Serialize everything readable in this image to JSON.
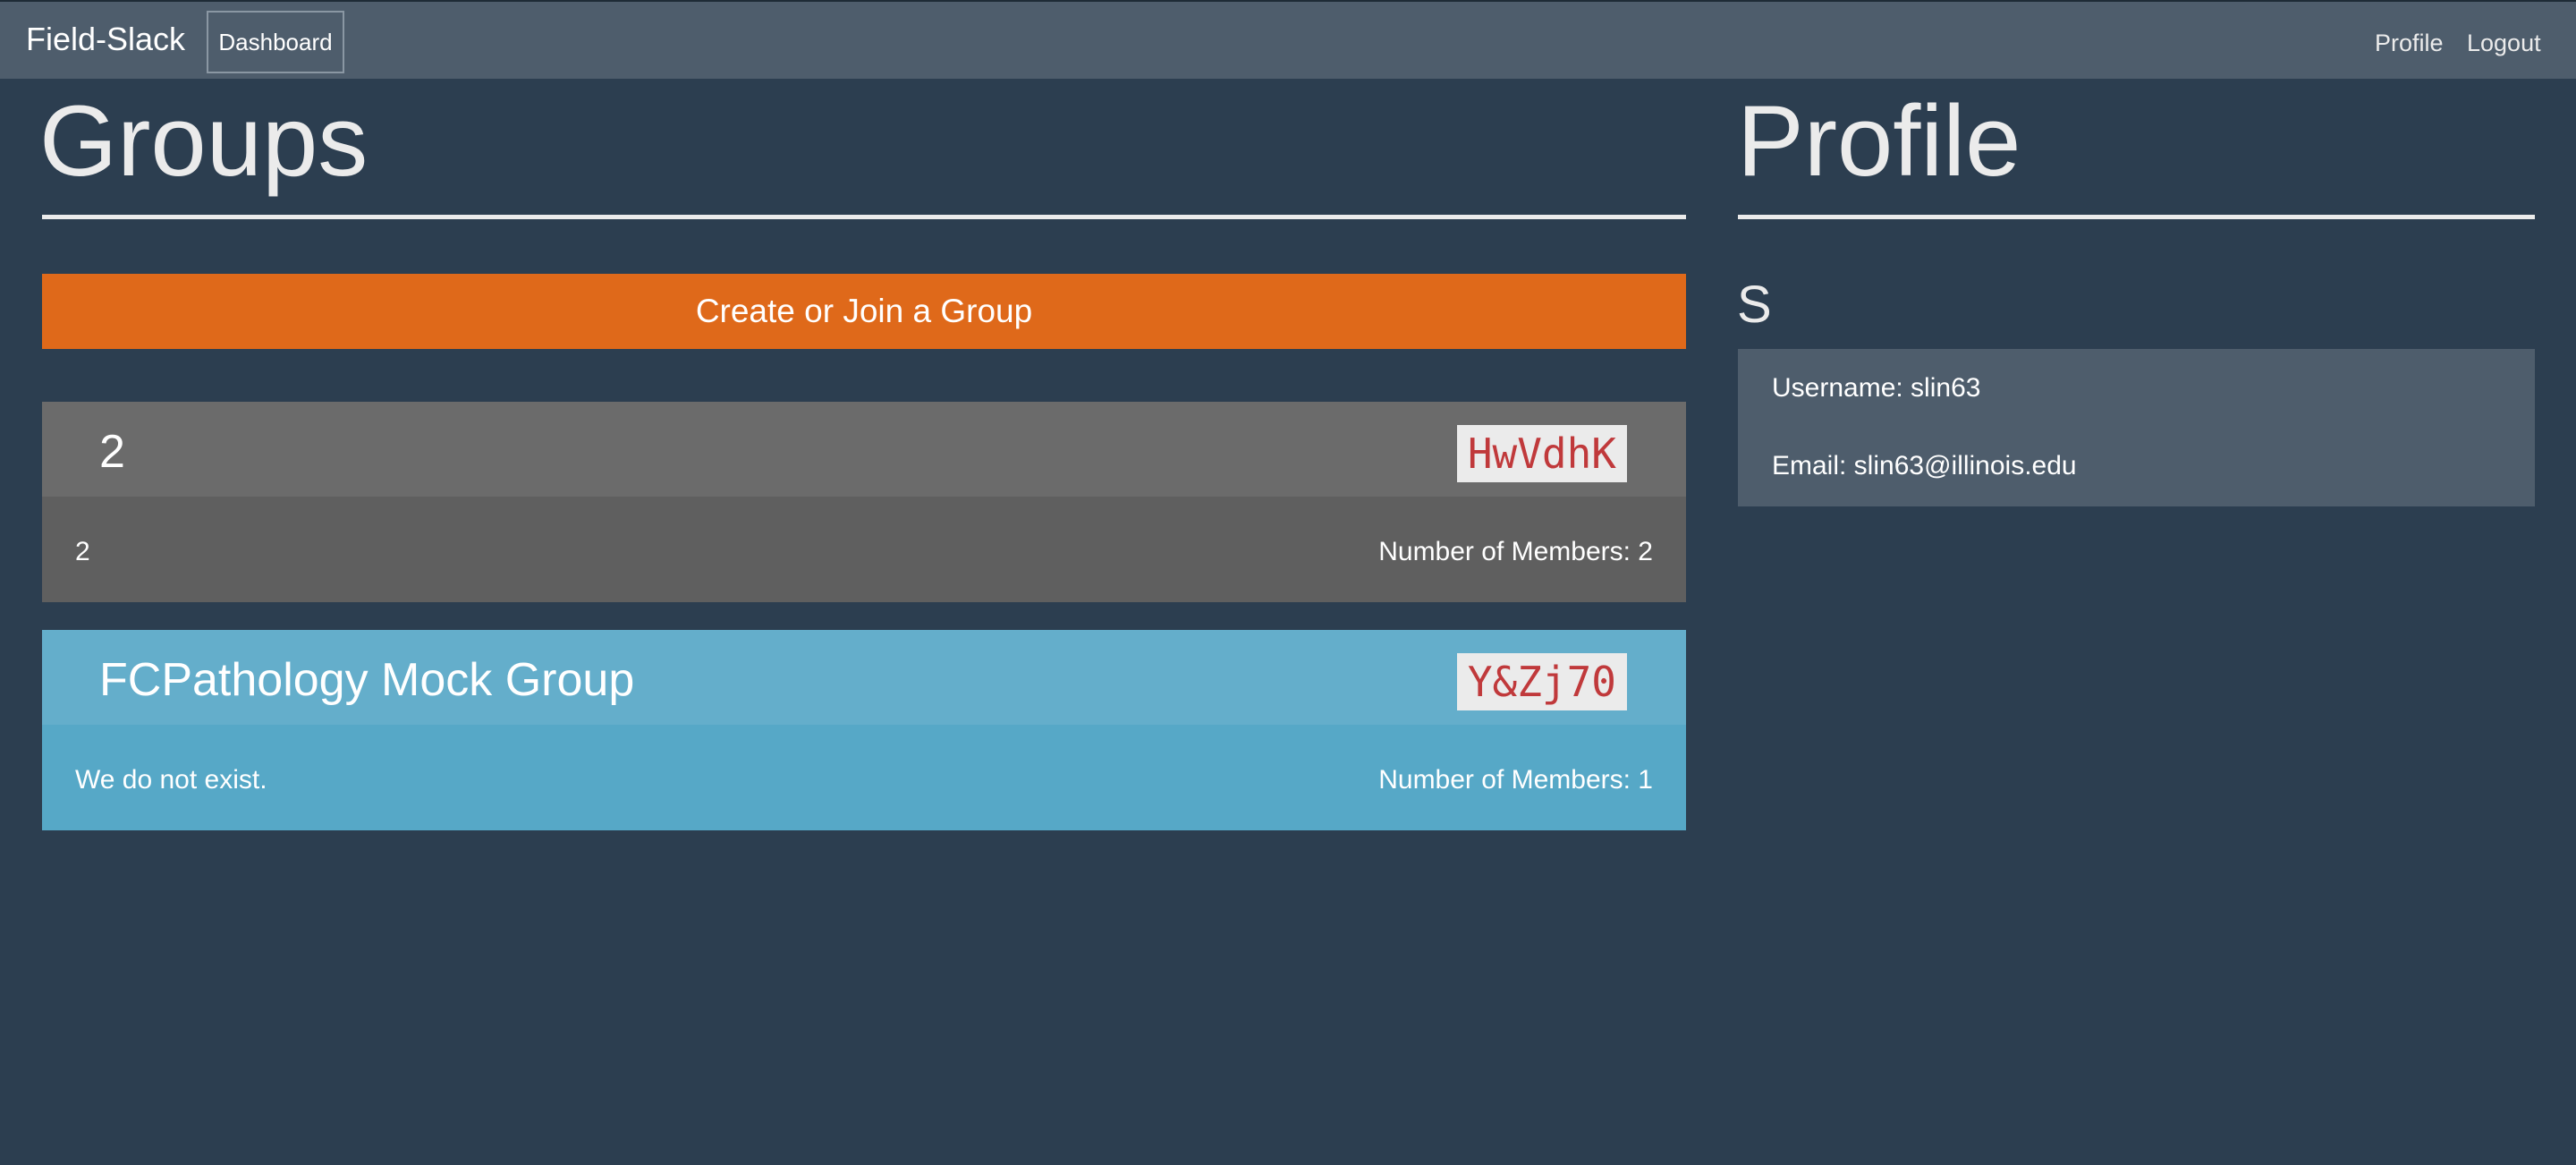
{
  "navbar": {
    "brand": "Field-Slack",
    "dashboard_label": "Dashboard",
    "profile_label": "Profile",
    "logout_label": "Logout"
  },
  "groups_section": {
    "title": "Groups",
    "create_button_label": "Create or Join a Group",
    "groups": [
      {
        "name": "2",
        "code": "HwVdhK",
        "description": "2",
        "members_text": "Number of Members: 2"
      },
      {
        "name": "FCPathology Mock Group",
        "code": "Y&Zj70",
        "description": "We do not exist.",
        "members_text": "Number of Members: 1"
      }
    ]
  },
  "profile_section": {
    "title": "Profile",
    "initial": "S",
    "username_text": "Username: slin63",
    "email_text": "Email: slin63@illinois.edu"
  },
  "colors": {
    "background": "#2c3e50",
    "navbar": "#4e5d6c",
    "accent_orange": "#df691a",
    "group_gray": "#6b6b6b",
    "group_blue": "#64aecb",
    "code_text": "#c0393b"
  }
}
